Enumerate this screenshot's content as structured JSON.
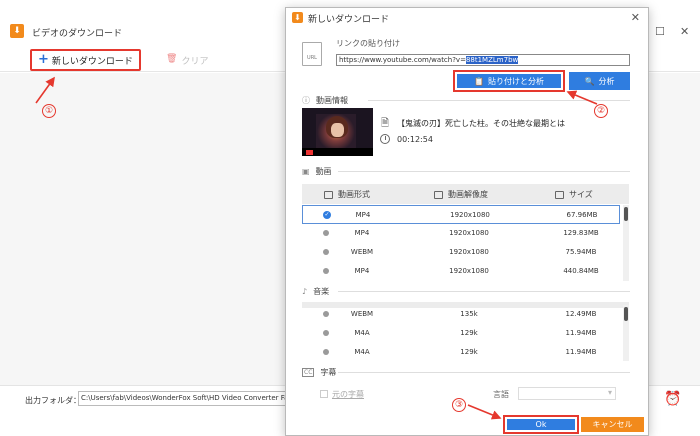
{
  "main": {
    "title": "ビデオのダウンロード",
    "new_download": "新しいダウンロード",
    "clear": "クリア",
    "output_label": "出力フォルダ：",
    "output_path": "C:\\Users\\fab\\Videos\\WonderFox Soft\\HD Video Converter Factory Pro\\"
  },
  "dialog": {
    "title": "新しいダウンロード",
    "link_label": "リンクの貼り付け",
    "url_prefix": "https://www.youtube.com/watch?v=",
    "url_selected": "88t1MZLm7bw",
    "paste_analyze": "貼り付けと分析",
    "analyze": "分析",
    "video_info_label": "動画情報",
    "video_title": "【鬼滅の刃】死亡した柱。その壮絶な最期とは",
    "duration": "00:12:54",
    "video_section": "動画",
    "video_headers": {
      "format": "動画形式",
      "resolution": "動画解像度",
      "size": "サイズ"
    },
    "video_rows": [
      {
        "format": "MP4",
        "res": "1920x1080",
        "size": "67.96MB"
      },
      {
        "format": "MP4",
        "res": "1920x1080",
        "size": "129.83MB"
      },
      {
        "format": "WEBM",
        "res": "1920x1080",
        "size": "75.94MB"
      },
      {
        "format": "MP4",
        "res": "1920x1080",
        "size": "440.84MB"
      }
    ],
    "audio_section": "音楽",
    "audio_rows": [
      {
        "format": "WEBM",
        "res": "135k",
        "size": "12.49MB"
      },
      {
        "format": "M4A",
        "res": "129k",
        "size": "11.94MB"
      },
      {
        "format": "M4A",
        "res": "129k",
        "size": "11.94MB"
      }
    ],
    "subtitle_section": "字幕",
    "subtitle_original": "元の字幕",
    "language_label": "言語",
    "ok": "Ok",
    "cancel": "キャンセル"
  },
  "annotations": {
    "n1": "①",
    "n2": "②",
    "n3": "③"
  },
  "colors": {
    "accent_blue": "#2f7de0",
    "orange": "#f28a1c",
    "annotation_red": "#e5382e"
  }
}
